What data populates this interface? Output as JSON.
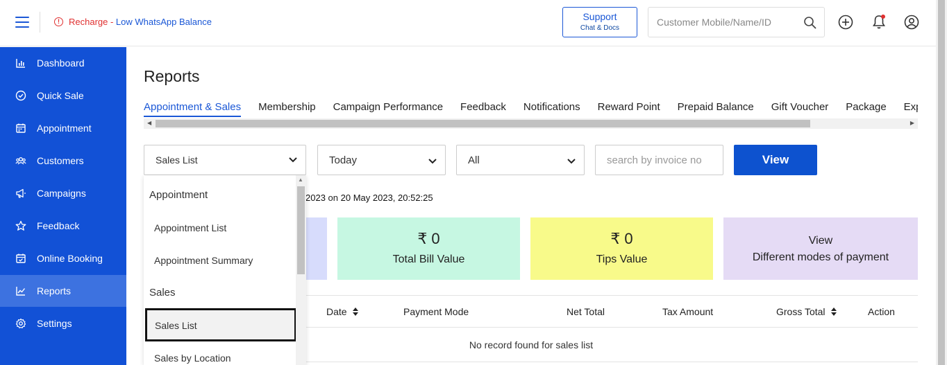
{
  "topbar": {
    "alert_prefix": "Recharge - ",
    "alert_text": "Low WhatsApp Balance",
    "support_title": "Support",
    "support_sub": "Chat & Docs",
    "search_placeholder": "Customer Mobile/Name/ID"
  },
  "sidebar": {
    "items": [
      {
        "label": "Dashboard",
        "icon": "bar-chart-icon"
      },
      {
        "label": "Quick Sale",
        "icon": "check-circle-icon"
      },
      {
        "label": "Appointment",
        "icon": "calendar-icon"
      },
      {
        "label": "Customers",
        "icon": "group-icon"
      },
      {
        "label": "Campaigns",
        "icon": "megaphone-icon"
      },
      {
        "label": "Feedback",
        "icon": "star-icon"
      },
      {
        "label": "Online Booking",
        "icon": "calendar-check-icon"
      },
      {
        "label": "Reports",
        "icon": "line-chart-icon",
        "active": true
      },
      {
        "label": "Settings",
        "icon": "gear-icon"
      }
    ]
  },
  "page": {
    "title": "Reports",
    "tabs": [
      "Appointment & Sales",
      "Membership",
      "Campaign Performance",
      "Feedback",
      "Notifications",
      "Reward Point",
      "Prepaid Balance",
      "Gift Voucher",
      "Package",
      "Expense"
    ]
  },
  "filters": {
    "report_type": "Sales List",
    "period": "Today",
    "scope": "All",
    "invoice_placeholder": "search by invoice no",
    "view_label": "View"
  },
  "updated": {
    "part1": "2023",
    "on": "on",
    "part2": "20 May 2023, 20:52:25"
  },
  "cards": {
    "bill_amount": "₹ 0",
    "bill_label": "Total Bill Value",
    "tips_amount": "₹ 0",
    "tips_label": "Tips Value",
    "modes_line1": "View",
    "modes_line2": "Different modes of payment"
  },
  "table": {
    "headers": [
      "Date",
      "Payment Mode",
      "Net Total",
      "Tax Amount",
      "Gross Total",
      "Action"
    ],
    "empty": "No record found for sales list"
  },
  "dropdown": {
    "group1": "Appointment",
    "opt1": "Appointment List",
    "opt2": "Appointment Summary",
    "group2": "Sales",
    "selected": "Sales List",
    "opt3": "Sales by Location"
  },
  "colors": {
    "brand": "#1251d6",
    "accent": "#1a57d6",
    "alert": "#e03030"
  }
}
